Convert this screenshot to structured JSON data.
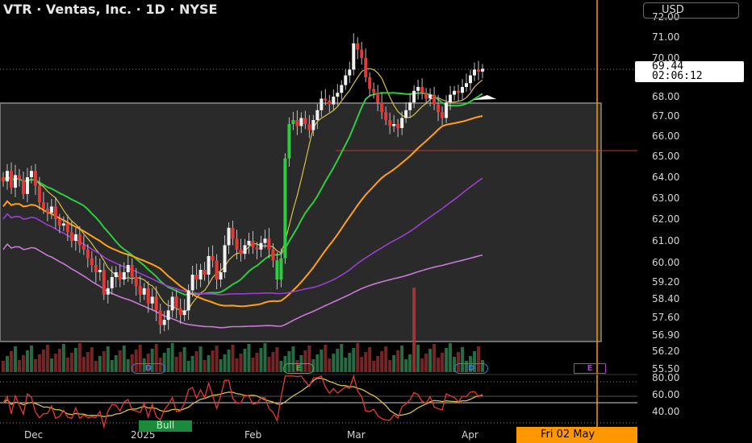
{
  "header": {
    "title": "VTR · Ventas, Inc. · 1D · NYSE",
    "currency_button": "USD"
  },
  "price_label": {
    "price": "69.44",
    "countdown": "02:06:12"
  },
  "date_flag": "Fri 02 May",
  "oscillator_label": "Bull",
  "events": [
    {
      "label": "D",
      "kind": "dividend",
      "color": "#3a7bd5"
    },
    {
      "label": "E",
      "kind": "earnings",
      "color": "#4caf50"
    },
    {
      "label": "D",
      "kind": "dividend",
      "color": "#3a7bd5"
    },
    {
      "label": "E",
      "kind": "earnings",
      "color": "#b23ec6"
    }
  ],
  "chart_data": {
    "type": "candlestick",
    "y_ticks": [
      "72.00",
      "71.00",
      "70.00",
      "68.00",
      "67.00",
      "66.00",
      "65.00",
      "64.00",
      "63.00",
      "62.00",
      "61.00",
      "60.00",
      "59.20",
      "58.40",
      "57.60",
      "56.90",
      "56.20",
      "55.50"
    ],
    "osc_ticks": [
      "80.00",
      "60.00",
      "40.00"
    ],
    "x_ticks": [
      "Dec",
      "2025",
      "Feb",
      "Mar",
      "Apr"
    ],
    "closes": [
      63.8,
      64.3,
      63.5,
      64.1,
      63.9,
      63.2,
      64.0,
      64.3,
      63.6,
      62.8,
      62.5,
      62.3,
      62.6,
      62.0,
      61.7,
      61.8,
      61.4,
      61.0,
      61.3,
      60.8,
      60.6,
      60.2,
      59.9,
      59.6,
      59.7,
      58.6,
      58.9,
      59.4,
      59.6,
      59.3,
      59.6,
      59.9,
      59.4,
      59.0,
      58.6,
      58.9,
      58.2,
      58.5,
      57.9,
      57.3,
      57.5,
      57.9,
      58.5,
      58.0,
      57.7,
      57.9,
      58.8,
      59.5,
      59.3,
      59.7,
      59.5,
      60.3,
      60.1,
      59.3,
      59.6,
      60.8,
      61.6,
      61.1,
      60.6,
      60.4,
      60.8,
      61.0,
      60.7,
      60.6,
      60.9,
      61.1,
      60.6,
      60.1,
      59.3,
      60.2,
      64.9,
      66.6,
      66.8,
      66.5,
      66.9,
      66.6,
      66.3,
      66.8,
      67.3,
      67.9,
      67.8,
      67.6,
      68.0,
      68.2,
      68.6,
      69.1,
      69.4,
      70.7,
      70.4,
      70.0,
      69.0,
      68.4,
      68.2,
      67.7,
      67.2,
      66.8,
      66.5,
      66.6,
      66.4,
      66.9,
      67.3,
      67.7,
      68.3,
      68.5,
      68.2,
      67.9,
      68.1,
      67.6,
      67.2,
      66.9,
      67.7,
      68.1,
      68.3,
      68.2,
      68.5,
      68.7,
      69.1,
      69.4,
      69.3,
      69.44
    ],
    "series": [
      {
        "name": "",
        "color": "#d6c04a"
      },
      {
        "name": "",
        "color": "#2ecc40"
      },
      {
        "name": "",
        "color": "#ff9f1a"
      },
      {
        "name": "",
        "color": "#9b3fd0"
      },
      {
        "name": "",
        "color": "#c87ad6"
      }
    ],
    "volume_spike_index": 102,
    "ylim": [
      55.5,
      72.0
    ],
    "grid": false
  }
}
